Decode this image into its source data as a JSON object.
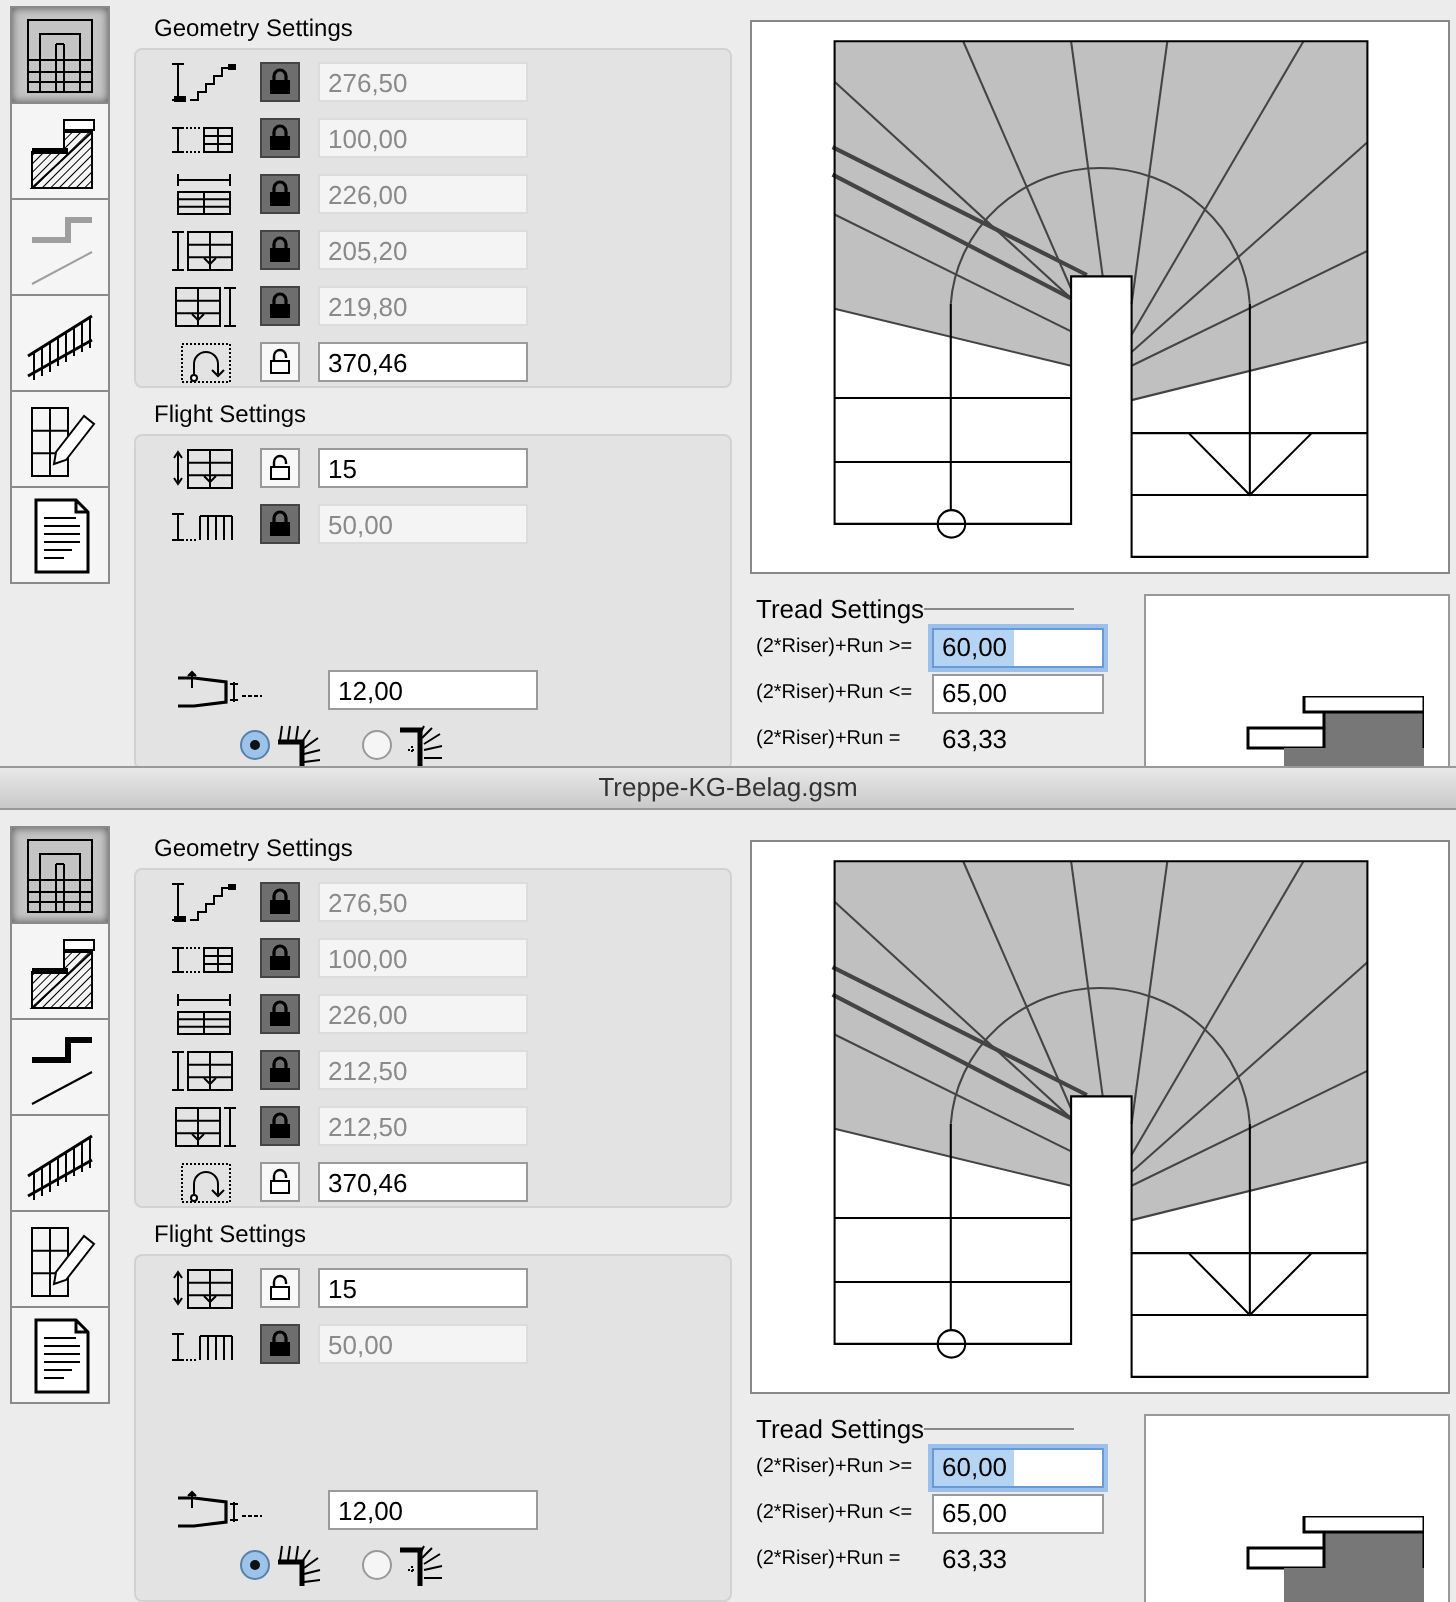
{
  "panes": [
    {
      "side_tabs": [
        {
          "kind": "plan",
          "selected": true,
          "disabled": false
        },
        {
          "kind": "section",
          "selected": false,
          "disabled": false
        },
        {
          "kind": "tread",
          "selected": false,
          "disabled": true
        },
        {
          "kind": "railing",
          "selected": false,
          "disabled": false
        },
        {
          "kind": "edit",
          "selected": false,
          "disabled": false
        },
        {
          "kind": "document",
          "selected": false,
          "disabled": false
        }
      ],
      "geometry": {
        "title": "Geometry Settings",
        "rows": [
          {
            "kind": "total-height",
            "locked": true,
            "value": "276,50"
          },
          {
            "kind": "flight-width",
            "locked": true,
            "value": "100,00"
          },
          {
            "kind": "stair-width",
            "locked": true,
            "value": "226,00"
          },
          {
            "kind": "left-length",
            "locked": true,
            "value": "205,20"
          },
          {
            "kind": "right-length",
            "locked": true,
            "value": "219,80"
          },
          {
            "kind": "walkline-length",
            "locked": false,
            "value": "370,46"
          }
        ]
      },
      "flight": {
        "title": "Flight Settings",
        "rows": [
          {
            "kind": "riser-count",
            "locked": false,
            "value": "15"
          },
          {
            "kind": "riser-height",
            "locked": true,
            "value": "50,00"
          }
        ],
        "min_thickness": {
          "value": "12,00"
        },
        "edge_options": [
          {
            "kind": "flush",
            "selected": true
          },
          {
            "kind": "offset",
            "selected": false
          }
        ]
      },
      "tread": {
        "title": "Tread Settings",
        "rows": [
          {
            "kind": "field",
            "label": "(2*Riser)+Run >=",
            "value": "60,00",
            "focused": true
          },
          {
            "kind": "field",
            "label": "(2*Riser)+Run <=",
            "value": "65,00",
            "focused": false
          },
          {
            "kind": "readout",
            "label": "(2*Riser)+Run =",
            "value": "63,33"
          }
        ]
      }
    },
    {
      "side_tabs": [
        {
          "kind": "plan",
          "selected": true,
          "disabled": false
        },
        {
          "kind": "section",
          "selected": false,
          "disabled": false
        },
        {
          "kind": "tread",
          "selected": false,
          "disabled": false
        },
        {
          "kind": "railing",
          "selected": false,
          "disabled": false
        },
        {
          "kind": "edit",
          "selected": false,
          "disabled": false
        },
        {
          "kind": "document",
          "selected": false,
          "disabled": false
        }
      ],
      "geometry": {
        "title": "Geometry Settings",
        "rows": [
          {
            "kind": "total-height",
            "locked": true,
            "value": "276,50"
          },
          {
            "kind": "flight-width",
            "locked": true,
            "value": "100,00"
          },
          {
            "kind": "stair-width",
            "locked": true,
            "value": "226,00"
          },
          {
            "kind": "left-length",
            "locked": true,
            "value": "212,50"
          },
          {
            "kind": "right-length",
            "locked": true,
            "value": "212,50"
          },
          {
            "kind": "walkline-length",
            "locked": false,
            "value": "370,46"
          }
        ]
      },
      "flight": {
        "title": "Flight Settings",
        "rows": [
          {
            "kind": "riser-count",
            "locked": false,
            "value": "15"
          },
          {
            "kind": "riser-height",
            "locked": true,
            "value": "50,00"
          }
        ],
        "min_thickness": {
          "value": "12,00"
        },
        "edge_options": [
          {
            "kind": "flush",
            "selected": true
          },
          {
            "kind": "offset",
            "selected": false
          }
        ]
      },
      "tread": {
        "title": "Tread Settings",
        "rows": [
          {
            "kind": "field",
            "label": "(2*Riser)+Run >=",
            "value": "60,00",
            "focused": true
          },
          {
            "kind": "field",
            "label": "(2*Riser)+Run <=",
            "value": "65,00",
            "focused": false
          },
          {
            "kind": "readout",
            "label": "(2*Riser)+Run =",
            "value": "63,33"
          }
        ]
      }
    }
  ],
  "window": {
    "title": "Treppe-KG-Belag.gsm"
  }
}
